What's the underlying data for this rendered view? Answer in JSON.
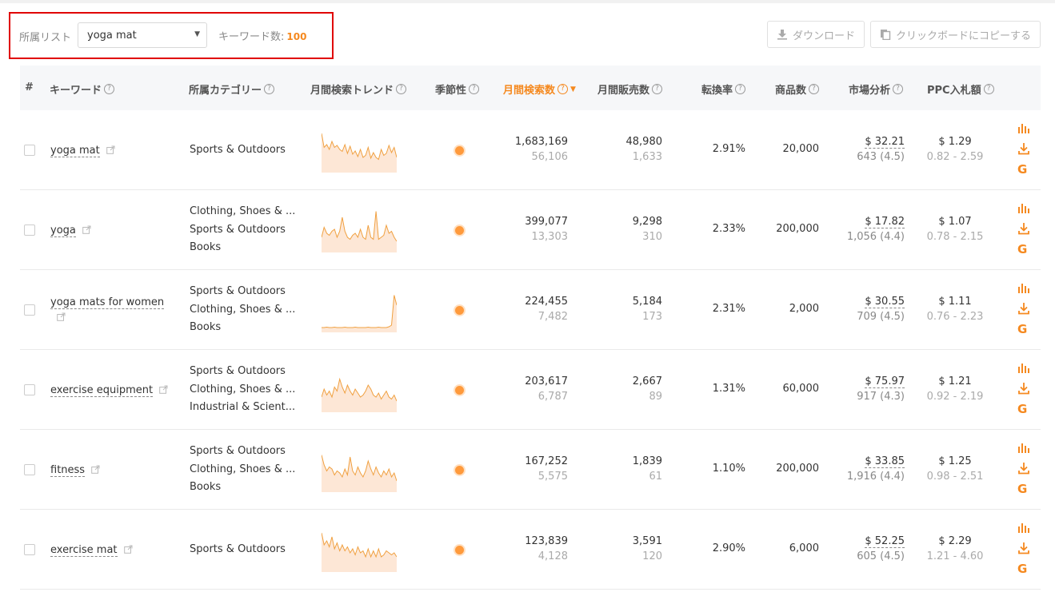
{
  "filter": {
    "list_label": "所属リスト",
    "list_value": "yoga mat",
    "keyword_count_label": "キーワード数:",
    "keyword_count": "100"
  },
  "toolbar": {
    "download_label": "ダウンロード",
    "copy_label": "クリックボードにコピーする"
  },
  "columns": {
    "index": "#",
    "keyword": "キーワード",
    "category": "所属カテゴリー",
    "trend": "月間検索トレンド",
    "seasonality": "季節性",
    "monthly_searches": "月間検索数",
    "monthly_sales": "月間販売数",
    "conversion": "転換率",
    "products": "商品数",
    "market": "市場分析",
    "ppc": "PPC入札額"
  },
  "colors": {
    "accent": "#f5891f",
    "highlight_border": "#e00000"
  },
  "rows": [
    {
      "keyword": "yoga mat",
      "categories": [
        "Sports & Outdoors"
      ],
      "trend": [
        0.9,
        0.55,
        0.62,
        0.5,
        0.7,
        0.55,
        0.6,
        0.5,
        0.45,
        0.62,
        0.4,
        0.58,
        0.38,
        0.46,
        0.32,
        0.5,
        0.3,
        0.35,
        0.55,
        0.28,
        0.42,
        0.3,
        0.25,
        0.5,
        0.35,
        0.4,
        0.6,
        0.42,
        0.55,
        0.3
      ],
      "searches": "1,683,169",
      "searches_sub": "56,106",
      "sales": "48,980",
      "sales_sub": "1,633",
      "conversion": "2.91%",
      "products": "20,000",
      "price": "$ 32.21",
      "reviews": "643 (4.5)",
      "ppc": "$ 1.29",
      "ppc_range": "0.82 - 2.59"
    },
    {
      "keyword": "yoga",
      "categories": [
        "Clothing, Shoes & ...",
        "Sports & Outdoors",
        "Books"
      ],
      "trend": [
        0.3,
        0.55,
        0.4,
        0.35,
        0.45,
        0.5,
        0.3,
        0.45,
        0.8,
        0.45,
        0.3,
        0.25,
        0.35,
        0.4,
        0.3,
        0.5,
        0.3,
        0.25,
        0.6,
        0.3,
        0.25,
        0.95,
        0.25,
        0.3,
        0.35,
        0.6,
        0.4,
        0.45,
        0.3,
        0.2
      ],
      "searches": "399,077",
      "searches_sub": "13,303",
      "sales": "9,298",
      "sales_sub": "310",
      "conversion": "2.33%",
      "products": "200,000",
      "price": "$ 17.82",
      "reviews": "1,056 (4.4)",
      "ppc": "$ 1.07",
      "ppc_range": "0.78 - 2.15"
    },
    {
      "keyword": "yoga mats for women",
      "categories": [
        "Sports & Outdoors",
        "Clothing, Shoes & ...",
        "Books"
      ],
      "trend": [
        0.04,
        0.04,
        0.05,
        0.04,
        0.04,
        0.05,
        0.04,
        0.04,
        0.04,
        0.05,
        0.04,
        0.04,
        0.04,
        0.05,
        0.04,
        0.04,
        0.04,
        0.04,
        0.05,
        0.04,
        0.04,
        0.04,
        0.05,
        0.04,
        0.04,
        0.04,
        0.06,
        0.1,
        0.85,
        0.6
      ],
      "searches": "224,455",
      "searches_sub": "7,482",
      "sales": "5,184",
      "sales_sub": "173",
      "conversion": "2.31%",
      "products": "2,000",
      "price": "$ 30.55",
      "reviews": "709 (4.5)",
      "ppc": "$ 1.11",
      "ppc_range": "0.76 - 2.23"
    },
    {
      "keyword": "exercise equipment",
      "categories": [
        "Sports & Outdoors",
        "Clothing, Shoes & ...",
        "Industrial & Scient..."
      ],
      "trend": [
        0.3,
        0.5,
        0.35,
        0.45,
        0.3,
        0.55,
        0.45,
        0.75,
        0.55,
        0.4,
        0.6,
        0.45,
        0.35,
        0.5,
        0.4,
        0.3,
        0.35,
        0.45,
        0.6,
        0.5,
        0.35,
        0.3,
        0.4,
        0.25,
        0.35,
        0.45,
        0.3,
        0.25,
        0.35,
        0.2
      ],
      "searches": "203,617",
      "searches_sub": "6,787",
      "sales": "2,667",
      "sales_sub": "89",
      "conversion": "1.31%",
      "products": "60,000",
      "price": "$ 75.97",
      "reviews": "917 (4.3)",
      "ppc": "$ 1.21",
      "ppc_range": "0.92 - 2.19"
    },
    {
      "keyword": "fitness",
      "categories": [
        "Sports & Outdoors",
        "Clothing, Shoes & ...",
        "Books"
      ],
      "trend": [
        0.85,
        0.6,
        0.45,
        0.55,
        0.5,
        0.35,
        0.45,
        0.4,
        0.3,
        0.5,
        0.35,
        0.8,
        0.45,
        0.35,
        0.55,
        0.4,
        0.3,
        0.45,
        0.7,
        0.5,
        0.35,
        0.55,
        0.4,
        0.3,
        0.45,
        0.35,
        0.5,
        0.3,
        0.4,
        0.2
      ],
      "searches": "167,252",
      "searches_sub": "5,575",
      "sales": "1,839",
      "sales_sub": "61",
      "conversion": "1.10%",
      "products": "200,000",
      "price": "$ 33.85",
      "reviews": "1,916 (4.4)",
      "ppc": "$ 1.25",
      "ppc_range": "0.98 - 2.51"
    },
    {
      "keyword": "exercise mat",
      "categories": [
        "Sports & Outdoors"
      ],
      "trend": [
        0.9,
        0.6,
        0.7,
        0.55,
        0.8,
        0.5,
        0.65,
        0.45,
        0.6,
        0.45,
        0.55,
        0.4,
        0.5,
        0.35,
        0.55,
        0.4,
        0.45,
        0.3,
        0.5,
        0.3,
        0.45,
        0.3,
        0.5,
        0.3,
        0.35,
        0.45,
        0.4,
        0.35,
        0.4,
        0.3
      ],
      "searches": "123,839",
      "searches_sub": "4,128",
      "sales": "3,591",
      "sales_sub": "120",
      "conversion": "2.90%",
      "products": "6,000",
      "price": "$ 52.25",
      "reviews": "605 (4.5)",
      "ppc": "$ 2.29",
      "ppc_range": "1.21 - 4.60"
    }
  ]
}
